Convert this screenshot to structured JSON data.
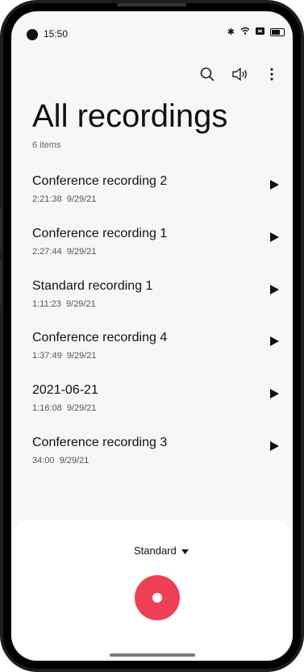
{
  "status_bar": {
    "time": "15:50",
    "icons": [
      "bluetooth-icon",
      "wifi-icon",
      "signal-icon",
      "battery-icon"
    ]
  },
  "toolbar": {
    "icons": [
      "search-icon",
      "speaker-icon",
      "more-icon"
    ]
  },
  "header": {
    "title": "All recordings",
    "count": "6 items"
  },
  "recordings": [
    {
      "name": "Conference recording 2",
      "duration": "2:21:38",
      "date": "9/29/21"
    },
    {
      "name": "Conference recording 1",
      "duration": "2:27:44",
      "date": "9/29/21"
    },
    {
      "name": "Standard recording 1",
      "duration": "1:11:23",
      "date": "9/29/21"
    },
    {
      "name": "Conference recording 4",
      "duration": "1:37:49",
      "date": "9/29/21"
    },
    {
      "name": "2021-06-21",
      "duration": "1:16:08",
      "date": "9/29/21"
    },
    {
      "name": "Conference recording 3",
      "duration": "34:00",
      "date": "9/29/21"
    }
  ],
  "bottom": {
    "mode_label": "Standard",
    "record_color": "#ee4055"
  }
}
